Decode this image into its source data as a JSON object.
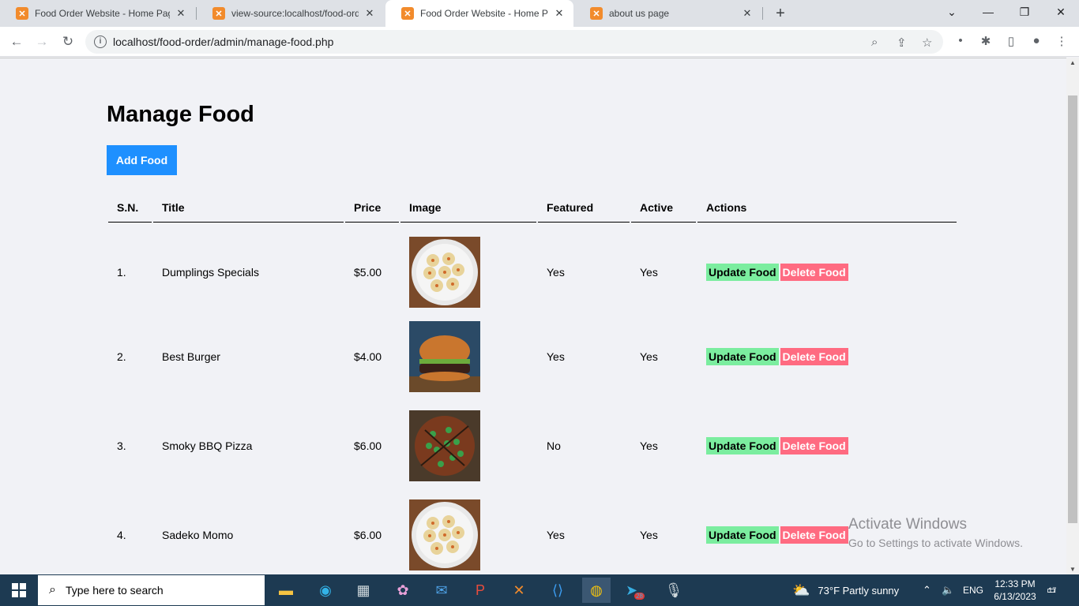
{
  "browser": {
    "tabs": [
      {
        "title": "Food Order Website - Home Pag"
      },
      {
        "title": "view-source:localhost/food-orde"
      },
      {
        "title": "Food Order Website - Home Pag"
      },
      {
        "title": "about us page"
      }
    ],
    "url": "localhost/food-order/admin/manage-food.php"
  },
  "page": {
    "title": "Manage Food",
    "add_button": "Add Food",
    "columns": [
      "S.N.",
      "Title",
      "Price",
      "Image",
      "Featured",
      "Active",
      "Actions"
    ],
    "rows": [
      {
        "sn": "1.",
        "title": "Dumplings Specials",
        "price": "$5.00",
        "featured": "Yes",
        "active": "Yes",
        "image": "dumplings"
      },
      {
        "sn": "2.",
        "title": "Best Burger",
        "price": "$4.00",
        "featured": "Yes",
        "active": "Yes",
        "image": "burger"
      },
      {
        "sn": "3.",
        "title": "Smoky BBQ Pizza",
        "price": "$6.00",
        "featured": "No",
        "active": "Yes",
        "image": "pizza"
      },
      {
        "sn": "4.",
        "title": "Sadeko Momo",
        "price": "$6.00",
        "featured": "Yes",
        "active": "Yes",
        "image": "dumplings"
      }
    ],
    "update_label": "Update Food",
    "delete_label": "Delete Food"
  },
  "watermark": {
    "line1": "Activate Windows",
    "line2": "Go to Settings to activate Windows."
  },
  "taskbar": {
    "search_placeholder": "Type here to search",
    "weather": "73°F  Partly sunny",
    "lang": "ENG",
    "time": "12:33 PM",
    "date": "6/13/2023",
    "telegram_badge": "28",
    "notifications": "17"
  },
  "colors": {
    "add_button": "#1e90ff",
    "update_button": "#7bed9f",
    "delete_button": "#ff6b81",
    "page_bg": "#f1f2f6"
  }
}
